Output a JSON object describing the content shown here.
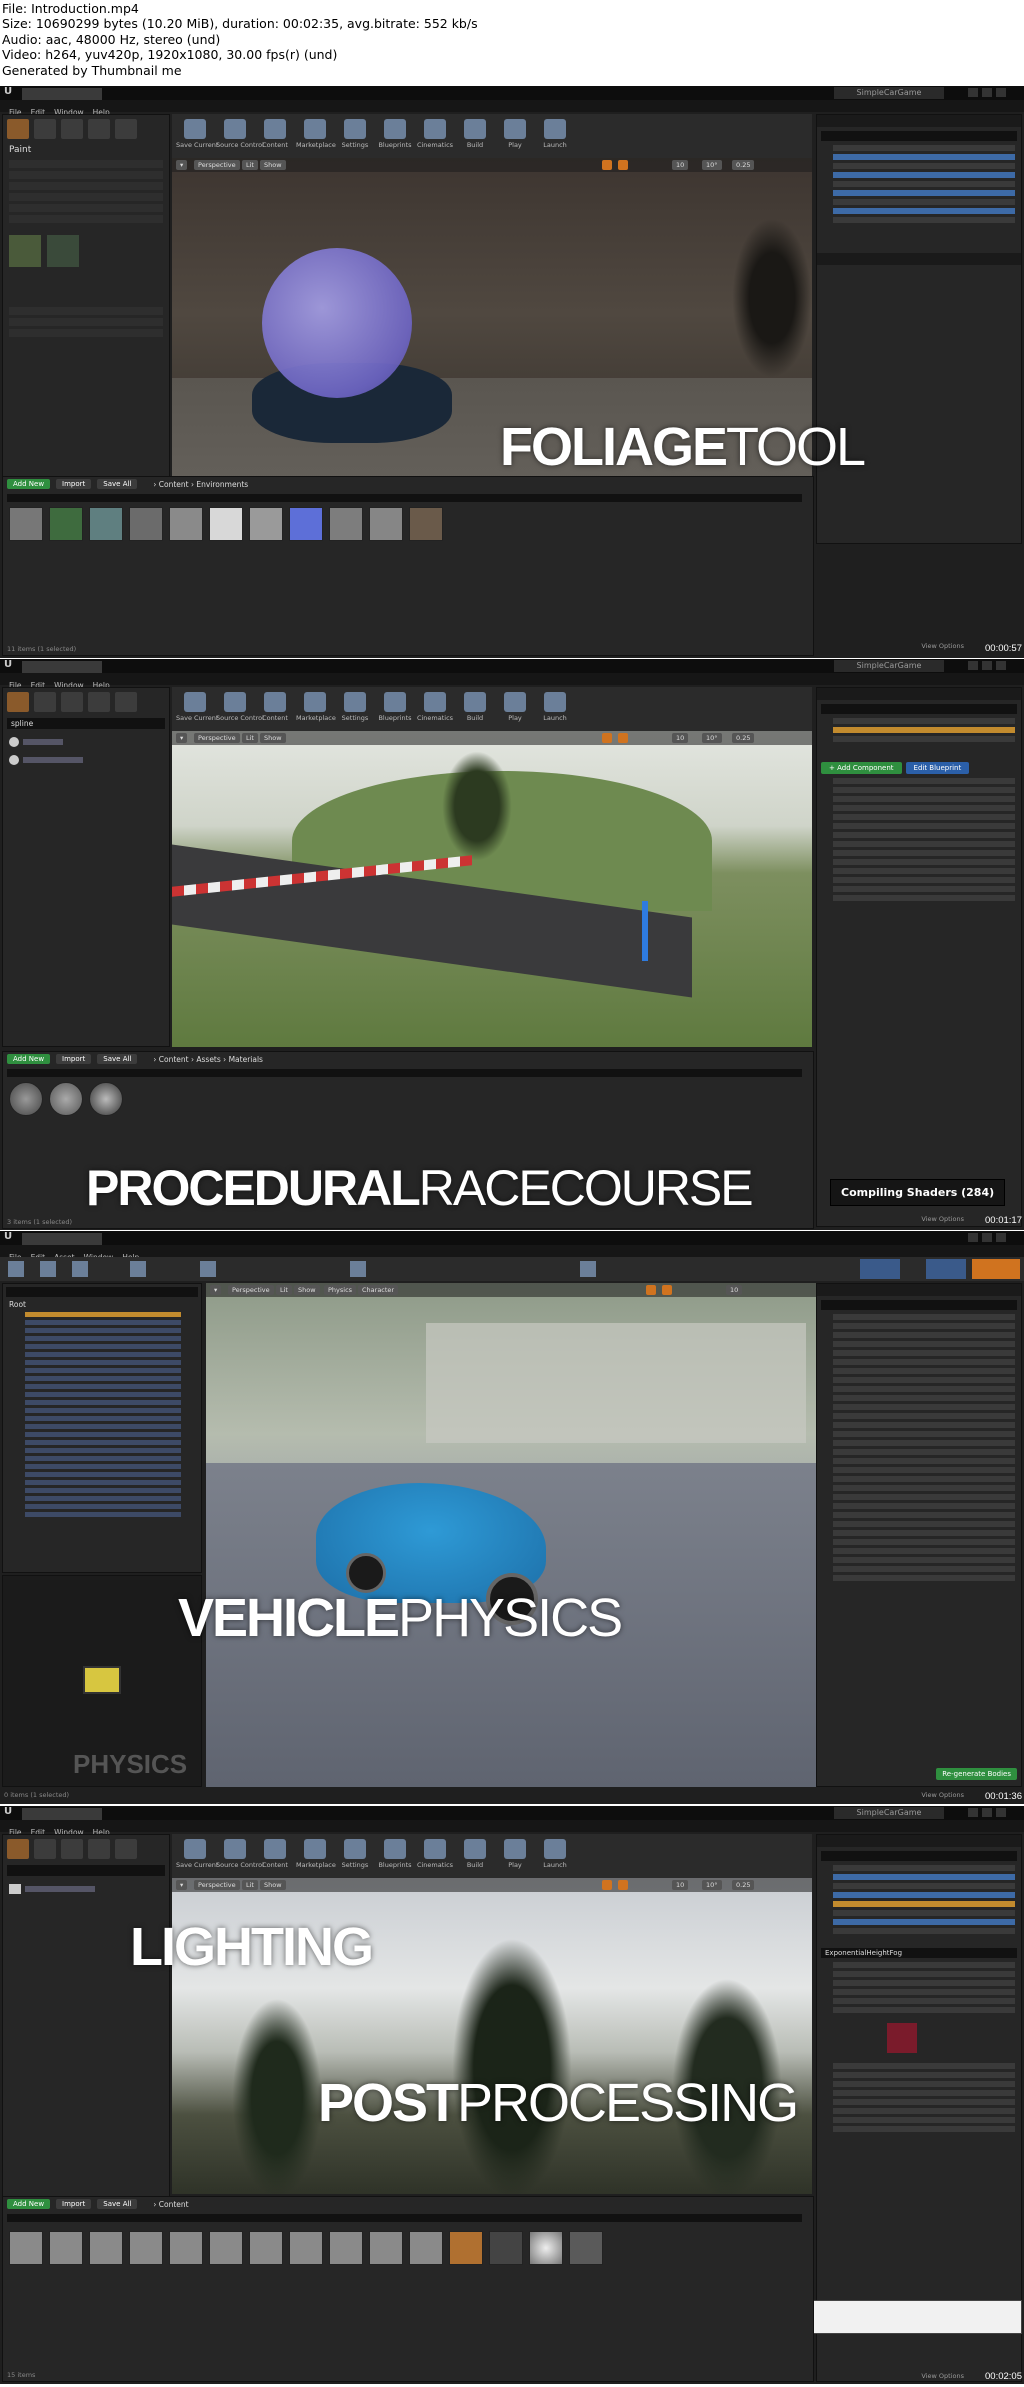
{
  "info": {
    "file_line": "File: Introduction.mp4",
    "size_line": "Size: 10690299 bytes (10.20 MiB), duration: 00:02:35, avg.bitrate: 552 kb/s",
    "audio_line": "Audio: aac, 48000 Hz, stereo (und)",
    "video_line": "Video: h264, yuv420p, 1920x1080, 30.00 fps(r) (und)",
    "generator_line": "Generated by Thumbnail me"
  },
  "frames": [
    {
      "caption_bold": "FOLIAGE",
      "caption_light": "TOOL",
      "timestamp": "00:00:57",
      "project": "SimpleCarGame",
      "menu": [
        "File",
        "Edit",
        "Window",
        "Help"
      ],
      "panel_title": "Paint",
      "breadcrumb": [
        "Content",
        "Environments"
      ],
      "cb_buttons": [
        "Add New",
        "Import",
        "Save All"
      ],
      "status": "11 items (1 selected)",
      "view_options": "View Options"
    },
    {
      "caption_bold": "PROCEDURAL",
      "caption_light": "RACECOURSE",
      "timestamp": "00:01:17",
      "project": "SimpleCarGame",
      "menu": [
        "File",
        "Edit",
        "Window",
        "Help"
      ],
      "panel_title": "spline",
      "breadcrumb": [
        "Content",
        "Assets",
        "Materials"
      ],
      "cb_buttons": [
        "Add New",
        "Import",
        "Save All"
      ],
      "status": "3 items (1 selected)",
      "view_options": "View Options",
      "badge": "Compiling Shaders (284)"
    },
    {
      "caption_bold": "VEHICLE",
      "caption_light": "PHYSICS",
      "timestamp": "00:01:36",
      "project": "",
      "menu": [
        "File",
        "Edit",
        "Asset",
        "Window",
        "Help"
      ],
      "panel_title": "Root",
      "watermark": "PHYSICS",
      "generate_button": "Re-generate Bodies",
      "status": "0 items (1 selected)",
      "view_options": "View Options"
    },
    {
      "caption_bold": "LIGHTING",
      "caption_light": "",
      "caption2_bold": "POST",
      "caption2_light": "PROCESSING",
      "timestamp": "00:02:05",
      "project": "SimpleCarGame",
      "menu": [
        "File",
        "Edit",
        "Window",
        "Help"
      ],
      "panel_title": "ExponentialHeightFog",
      "breadcrumb": [
        "Content"
      ],
      "cb_buttons": [
        "Add New",
        "Import",
        "Save All"
      ],
      "status": "15 items",
      "view_options": "View Options"
    }
  ],
  "toolbar": [
    "Save Current",
    "Source Control",
    "Content",
    "Marketplace",
    "Settings",
    "Blueprints",
    "Cinematics",
    "Build",
    "Play",
    "Launch"
  ],
  "colors": {
    "accent_orange": "#d0731f",
    "ue_green": "#2f8f3f",
    "selection_blue": "#3d6aa6"
  }
}
